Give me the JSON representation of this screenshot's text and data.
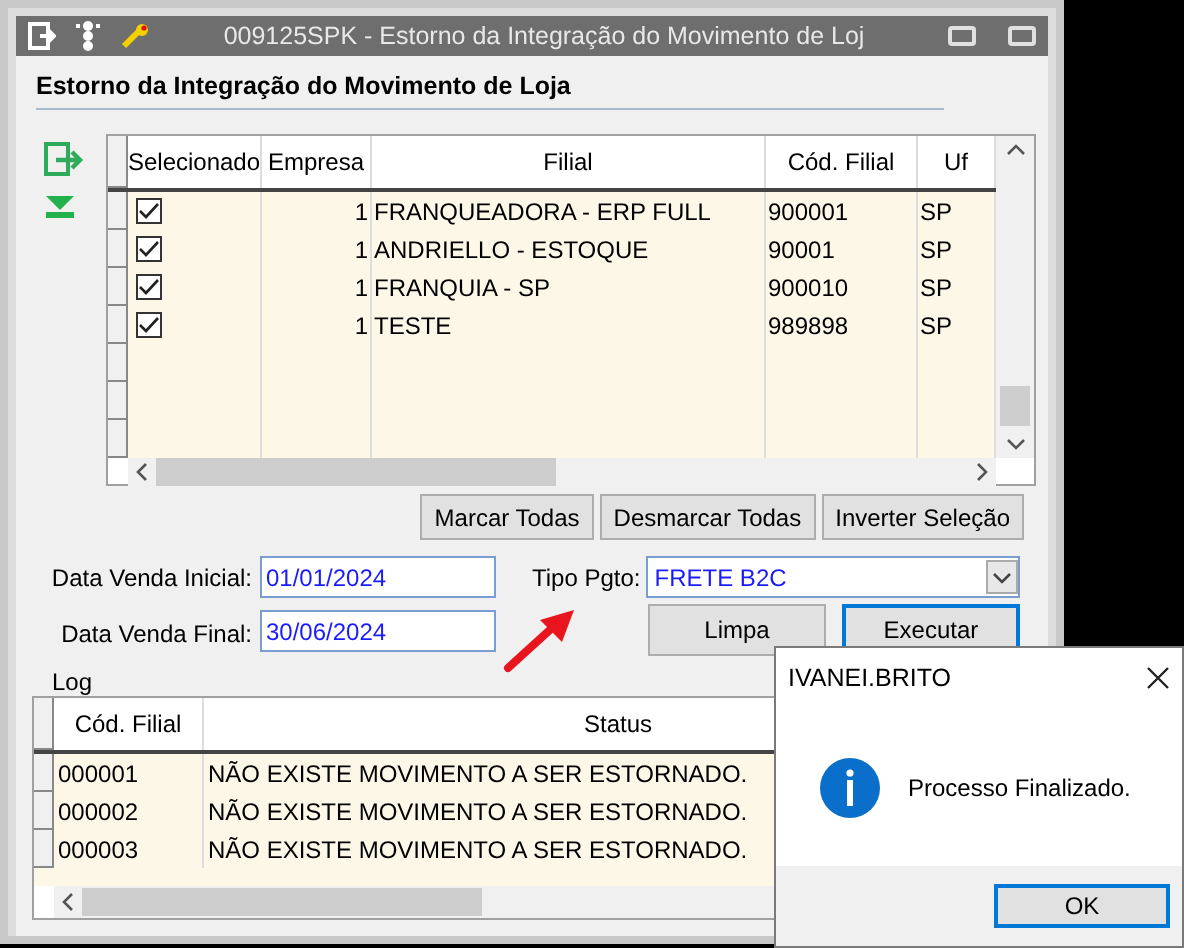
{
  "window": {
    "title": "009125SPK - Estorno da Integração do Movimento de Loj"
  },
  "heading": "Estorno da Integração do Movimento de Loja",
  "grid": {
    "columns": [
      "Selecionado",
      "Empresa",
      "Filial",
      "Cód. Filial",
      "Uf"
    ],
    "rows": [
      {
        "checked": true,
        "empresa": "1",
        "filial": "FRANQUEADORA - ERP FULL",
        "cod_filial": "900001",
        "uf": "SP"
      },
      {
        "checked": true,
        "empresa": "1",
        "filial": "ANDRIELLO - ESTOQUE",
        "cod_filial": "90001",
        "uf": "SP"
      },
      {
        "checked": true,
        "empresa": "1",
        "filial": "FRANQUIA - SP",
        "cod_filial": "900010",
        "uf": "SP"
      },
      {
        "checked": true,
        "empresa": "1",
        "filial": "TESTE",
        "cod_filial": "989898",
        "uf": "SP"
      }
    ]
  },
  "grid_buttons": [
    "Marcar Todas",
    "Desmarcar Todas",
    "Inverter Seleção"
  ],
  "filters": {
    "data_inicial": {
      "label": "Data Venda Inicial:",
      "value": "01/01/2024"
    },
    "data_final": {
      "label": "Data Venda Final:",
      "value": "30/06/2024"
    },
    "tipo_pgto": {
      "label": "Tipo Pgto:",
      "value": "FRETE B2C"
    }
  },
  "actions": [
    {
      "label": "Limpa",
      "focused": false
    },
    {
      "label": "Executar",
      "focused": true
    }
  ],
  "log": {
    "label": "Log",
    "columns": [
      "Cód. Filial",
      "Status"
    ],
    "rows": [
      {
        "cod_filial": "000001",
        "status": "NÃO EXISTE MOVIMENTO A SER ESTORNADO."
      },
      {
        "cod_filial": "000002",
        "status": "NÃO EXISTE MOVIMENTO A SER ESTORNADO."
      },
      {
        "cod_filial": "000003",
        "status": "NÃO EXISTE MOVIMENTO A SER ESTORNADO."
      }
    ]
  },
  "dialog": {
    "title": "IVANEI.BRITO",
    "message": "Processo Finalizado.",
    "button": "OK"
  }
}
